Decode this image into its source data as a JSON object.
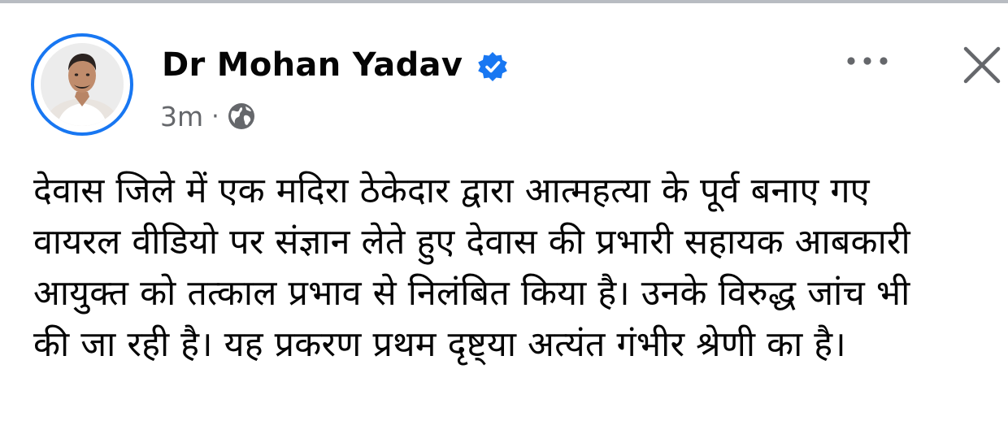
{
  "post": {
    "author": "Dr Mohan Yadav",
    "verified": true,
    "time": "3m",
    "separator": "·",
    "audience_icon": "globe-icon",
    "body_lines": [
      "देवास जिले में एक मदिरा ठेकेदार द्वारा आत्महत्या के पूर्व बनाए गए",
      "वायरल वीडियो पर संज्ञान लेते हुए देवास की प्रभारी सहायक आबकारी",
      "आयुक्त को तत्काल प्रभाव से निलंबित किया है। उनके विरुद्ध जांच भी",
      "की जा रही है। यह प्रकरण प्रथम दृष्ट्या अत्यंत गंभीर श्रेणी का है।"
    ]
  },
  "icons": {
    "verified": "verified-badge-icon",
    "more": "more-options-icon",
    "close": "close-icon"
  },
  "colors": {
    "accent": "#1877f2",
    "secondary_text": "#65676b",
    "primary_text": "#050505"
  }
}
